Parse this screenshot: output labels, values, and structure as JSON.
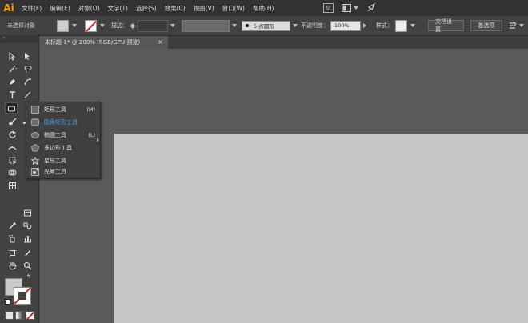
{
  "app": {
    "logo": "Ai"
  },
  "menu": [
    "文件(F)",
    "编辑(E)",
    "对象(O)",
    "文字(T)",
    "选择(S)",
    "效果(C)",
    "视图(V)",
    "窗口(W)",
    "帮助(H)"
  ],
  "menu_extras": {
    "st_badge": "St"
  },
  "control_bar": {
    "no_selection": "未选择对象",
    "stroke_label": "描边：",
    "brush_value": "5 点圆形",
    "opacity_label": "不透明度：",
    "opacity_value": "100%",
    "style_label": "样式：",
    "doc_setup": "文档设置",
    "preferences": "首选项"
  },
  "document_tab": {
    "title": "未标题-1* @ 200% (RGB/GPU 预览)",
    "close": "×"
  },
  "flyout": {
    "items": [
      {
        "label": "矩形工具",
        "shortcut": "(M)",
        "icon": "rectangle-icon"
      },
      {
        "label": "圆角矩形工具",
        "shortcut": "",
        "icon": "rounded-rectangle-icon",
        "active": true
      },
      {
        "label": "椭圆工具",
        "shortcut": "(L)",
        "icon": "ellipse-icon"
      },
      {
        "label": "多边形工具",
        "shortcut": "",
        "icon": "polygon-icon"
      },
      {
        "label": "星形工具",
        "shortcut": "",
        "icon": "star-icon"
      },
      {
        "label": "光晕工具",
        "shortcut": "",
        "icon": "flare-icon"
      }
    ]
  },
  "colors": {
    "menubar": "#323232",
    "panel": "#424242",
    "workspace": "#5a5a5a",
    "artboard": "#c6c4c4",
    "accent": "#4c9ee8",
    "logo": "#ff9a00"
  }
}
